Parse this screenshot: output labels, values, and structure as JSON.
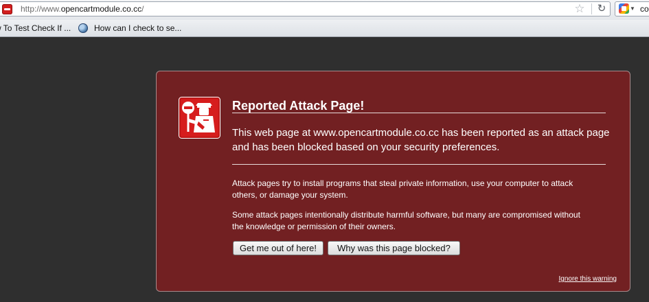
{
  "browser": {
    "url_prefix": "http://www.",
    "url_domain": "opencartmodule.co.cc",
    "url_suffix": "/",
    "site_icon": "attack-site-icon",
    "star_icon": "bookmark-star-icon",
    "reload_icon": "reload-icon",
    "search_engine_icon": "google-icon",
    "search_text": "co"
  },
  "bookmarks": [
    {
      "label": "w To Test Check If ..."
    },
    {
      "label": "How can I check to se...",
      "icon": "globe-icon"
    }
  ],
  "warning": {
    "title": "Reported Attack Page!",
    "lead": "This web page at www.opencartmodule.co.cc has been reported as an attack page and has been blocked based on your security preferences.",
    "detail_1": "Attack pages try to install programs that steal private information, use your computer to attack others, or damage your system.",
    "detail_2": "Some attack pages intentionally distribute harmful software, but many are compromised without the knowledge or permission of their owners.",
    "get_out_label": "Get me out of here!",
    "why_blocked_label": "Why was this page blocked?",
    "ignore_label": "Ignore this warning",
    "icon": "police-officer-stop-icon",
    "panel_color": "#722022",
    "icon_color": "#d61d1d"
  }
}
